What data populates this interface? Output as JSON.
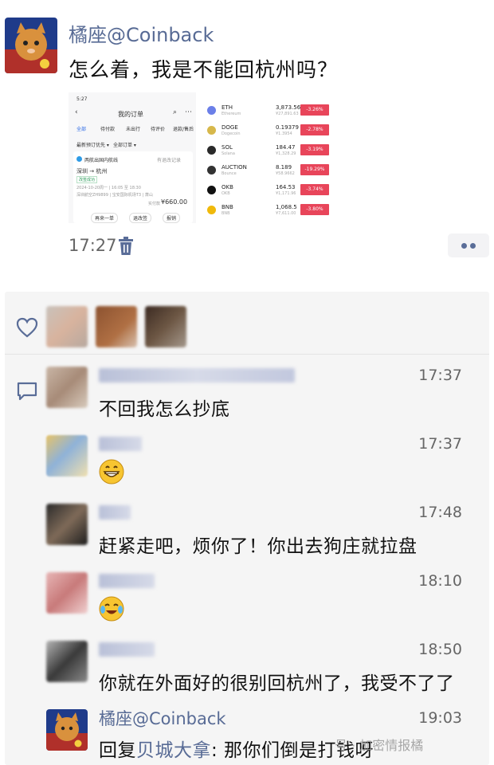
{
  "post": {
    "author": "橘座@Coinback",
    "text": "怎么着，我是不能回杭州吗？",
    "time": "17:27",
    "delete_icon": "trash-icon",
    "more_icon": "more-dots-icon"
  },
  "screenshot_left": {
    "status_time": "5:27",
    "title": "我的订单",
    "tabs": [
      "全部",
      "待付款",
      "未出行",
      "待评价",
      "退款/售后"
    ],
    "filters": [
      "最新预订优先 ▾",
      "全部订单 ▾"
    ],
    "card_title": "两航出国内航线",
    "card_action": "有退改记录",
    "route": "深圳 → 杭州",
    "badge": "改签成功",
    "flight_line": "2024-10-20周一 | 16:05 至 18:30",
    "flight_line2": "深圳航空ZH9899 | 宝安国际机场T3 | 萧山",
    "paid_label": "实付款",
    "price": "¥660.00",
    "buttons": [
      "再来一单",
      "退改签",
      "报销"
    ]
  },
  "screenshot_right": {
    "coins": [
      {
        "symbol": "ETH",
        "name": "Ethereum",
        "price": "3,873.56",
        "sub": "¥27,891.63",
        "change": "-3.26%",
        "color": "#6b7fe8"
      },
      {
        "symbol": "DOGE",
        "name": "Dogecoin",
        "price": "0.19379",
        "sub": "¥1.3954",
        "change": "-2.78%",
        "color": "#d7b84b"
      },
      {
        "symbol": "SOL",
        "name": "Solana",
        "price": "184.47",
        "sub": "¥1,328.29",
        "change": "-3.19%",
        "color": "#2a2a2a"
      },
      {
        "symbol": "AUCTION",
        "name": "Bounce",
        "price": "8.189",
        "sub": "¥58.9662",
        "change": "-19.29%",
        "color": "#333333"
      },
      {
        "symbol": "OKB",
        "name": "OKB",
        "price": "164.53",
        "sub": "¥1,171.96",
        "change": "-3.74%",
        "color": "#111111"
      },
      {
        "symbol": "BNB",
        "name": "BNB",
        "price": "1,068.5",
        "sub": "¥7,611.00",
        "change": "-3.80%",
        "color": "#f0b90b"
      }
    ]
  },
  "feedback": {
    "like_icon": "heart-icon",
    "comment_icon": "comment-icon",
    "comments": [
      {
        "name": "",
        "time": "17:37",
        "text": "不回我怎么抄底",
        "emoji": ""
      },
      {
        "name": "",
        "time": "17:37",
        "text": "",
        "emoji": "grin-emoji"
      },
      {
        "name": "",
        "time": "17:48",
        "text": "赶紧走吧，烦你了！你出去狗庄就拉盘",
        "emoji": ""
      },
      {
        "name": "",
        "time": "18:10",
        "text": "",
        "emoji": "laugh-cry-emoji"
      },
      {
        "name": "",
        "time": "18:50",
        "text": "你就在外面好的很别回杭州了，我受不了了",
        "emoji": ""
      },
      {
        "name": "橘座@Coinback",
        "time": "19:03",
        "reply_prefix": "回复",
        "reply_to": "贝城大拿",
        "reply_text": ": 那你们倒是打钱呀",
        "emoji": ""
      }
    ]
  },
  "watermark": "号 · 加密情报橘"
}
